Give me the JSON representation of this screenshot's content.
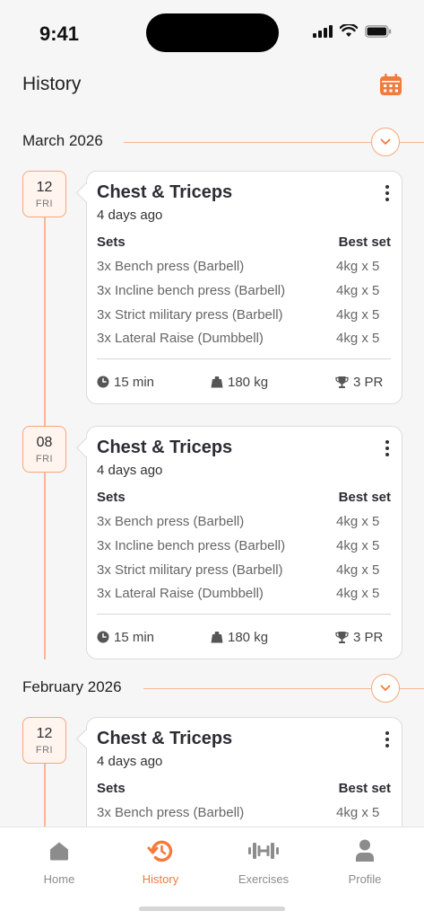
{
  "status_bar": {
    "time": "9:41"
  },
  "header": {
    "title": "History",
    "calendar_icon": "calendar-icon"
  },
  "colors": {
    "accent": "#f47a3c",
    "accent_light": "#fff4ee",
    "timeline": "#f6b894"
  },
  "columns": {
    "sets": "Sets",
    "best_set": "Best set"
  },
  "months": [
    {
      "label": "March 2026"
    },
    {
      "label": "February 2026"
    }
  ],
  "workouts": [
    {
      "day": "12",
      "weekday": "FRI",
      "title": "Chest & Triceps",
      "subtitle": "4 days ago",
      "exercises": [
        {
          "name": "3x Bench press (Barbell)",
          "best": "4kg x 5"
        },
        {
          "name": "3x Incline bench press (Barbell)",
          "best": "4kg x 5"
        },
        {
          "name": "3x Strict military press (Barbell)",
          "best": "4kg x 5"
        },
        {
          "name": "3x Lateral Raise (Dumbbell)",
          "best": "4kg x 5"
        }
      ],
      "duration": "15 min",
      "volume": "180 kg",
      "prs": "3 PR"
    },
    {
      "day": "08",
      "weekday": "FRI",
      "title": "Chest & Triceps",
      "subtitle": "4 days ago",
      "exercises": [
        {
          "name": "3x Bench press (Barbell)",
          "best": "4kg x 5"
        },
        {
          "name": "3x Incline bench press (Barbell)",
          "best": "4kg x 5"
        },
        {
          "name": "3x Strict military press (Barbell)",
          "best": "4kg x 5"
        },
        {
          "name": "3x Lateral Raise (Dumbbell)",
          "best": "4kg x 5"
        }
      ],
      "duration": "15 min",
      "volume": "180 kg",
      "prs": "3 PR"
    },
    {
      "day": "12",
      "weekday": "FRI",
      "title": "Chest & Triceps",
      "subtitle": "4 days ago",
      "exercises": [
        {
          "name": "3x Bench press (Barbell)",
          "best": "4kg x 5"
        }
      ]
    }
  ],
  "tabs": [
    {
      "label": "Home",
      "icon": "home-icon",
      "active": false
    },
    {
      "label": "History",
      "icon": "history-icon",
      "active": true
    },
    {
      "label": "Exercises",
      "icon": "dumbbell-icon",
      "active": false
    },
    {
      "label": "Profile",
      "icon": "profile-icon",
      "active": false
    }
  ]
}
